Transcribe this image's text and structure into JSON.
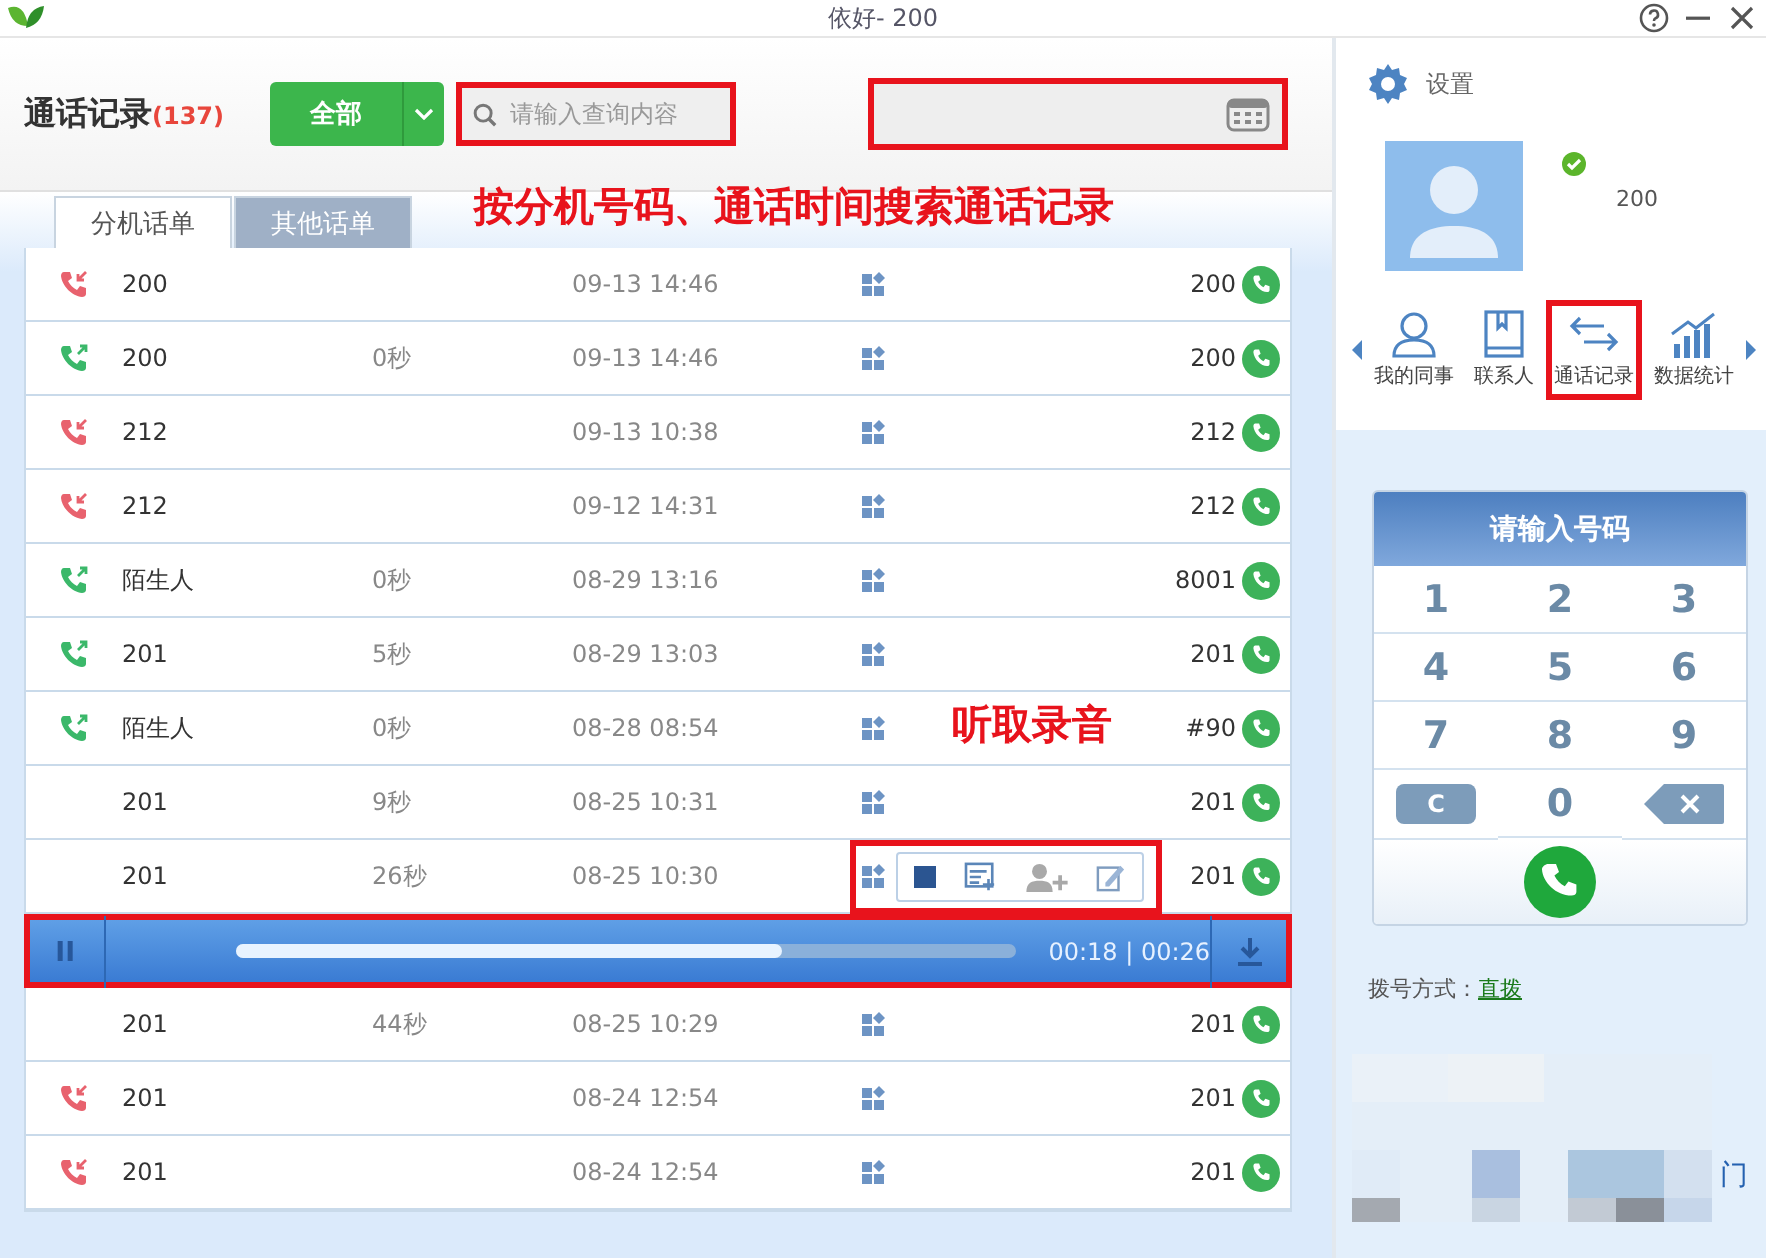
{
  "window": {
    "title": "依好- 200"
  },
  "header": {
    "title": "通话记录",
    "count": "(137)",
    "filter_button": "全部",
    "search": {
      "placeholder": "请输入查询内容",
      "highlighted": true
    },
    "date_field": {
      "highlighted": true
    }
  },
  "tabs": [
    {
      "label": "分机话单",
      "selected": true
    },
    {
      "label": "其他话单",
      "selected": false
    }
  ],
  "annotations": [
    {
      "text": "按分机号码、通话时间搜索通话记录"
    },
    {
      "text": "听取录音"
    }
  ],
  "calls": [
    {
      "kind": "missed",
      "name": "200",
      "time": "09-13 14:46",
      "number": "200"
    },
    {
      "kind": "outgoing",
      "name": "200",
      "duration": "0秒",
      "time": "09-13 14:46",
      "number": "200"
    },
    {
      "kind": "missed",
      "name": "212",
      "time": "09-13 10:38",
      "number": "212"
    },
    {
      "kind": "missed",
      "name": "212",
      "time": "09-12 14:31",
      "number": "212"
    },
    {
      "kind": "outgoing",
      "name": "陌生人",
      "duration": "0秒",
      "time": "08-29 13:16",
      "number": "8001"
    },
    {
      "kind": "outgoing",
      "name": "201",
      "duration": "5秒",
      "time": "08-29 13:03",
      "number": "201"
    },
    {
      "kind": "outgoing",
      "name": "陌生人",
      "duration": "0秒",
      "time": "08-28 08:54",
      "number": "#90"
    },
    {
      "kind": "plain",
      "name": "201",
      "duration": "9秒",
      "time": "08-25 10:31",
      "number": "201"
    },
    {
      "kind": "plain",
      "name": "201",
      "duration": "26秒",
      "time": "08-25 10:30",
      "number": "201",
      "action_popup": {
        "highlighted": true
      }
    },
    {
      "kind": "player",
      "playing": true,
      "level": 0.7,
      "time": "00:18 | 00:26",
      "highlighted": true
    },
    {
      "kind": "plain",
      "name": "201",
      "duration": "44秒",
      "time": "08-25 10:29",
      "number": "201"
    },
    {
      "kind": "missed",
      "name": "201",
      "time": "08-24 12:54",
      "number": "201"
    },
    {
      "kind": "missed",
      "name": "201",
      "time": "08-24 12:54",
      "number": "201"
    }
  ],
  "sidebar": {
    "settings": "设置",
    "user": {
      "extension": "200",
      "online": true
    },
    "nav": [
      {
        "kind": "person",
        "label": "我的同事",
        "highlighted": false
      },
      {
        "kind": "book",
        "label": "联系人",
        "highlighted": false
      },
      {
        "kind": "arrows",
        "label": "通话记录",
        "highlighted": true
      },
      {
        "kind": "chart",
        "label": "数据统计",
        "highlighted": false
      }
    ],
    "dialpad": {
      "title": "请输入号码",
      "keys": [
        "1",
        "2",
        "3",
        "4",
        "5",
        "6",
        "7",
        "8",
        "9"
      ],
      "clear_key": "C",
      "zero_key": "0"
    },
    "dial_mode": {
      "label": "拨号方式：",
      "value": "直拨"
    },
    "edge_text": "门"
  }
}
